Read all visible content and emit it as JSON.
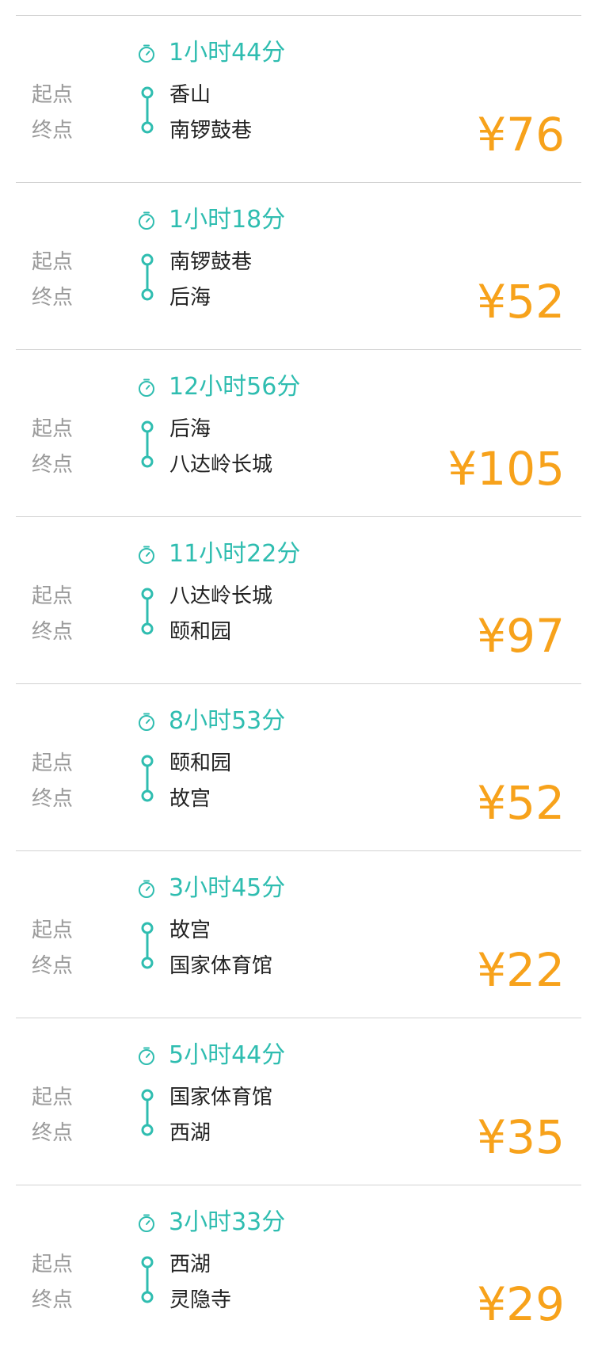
{
  "labels": {
    "start": "起点",
    "end": "终点"
  },
  "currency_symbol": "¥",
  "colors": {
    "accent_teal": "#2fbdb0",
    "price_orange": "#f7a21b",
    "label_gray": "#9a9a9a",
    "text_dark": "#222222",
    "divider": "#d2d2d2"
  },
  "icons": {
    "duration": "stopwatch-icon",
    "route": "route-line-icon"
  },
  "trips": [
    {
      "duration": "1小时44分",
      "from": "香山",
      "to": "南锣鼓巷",
      "price": "¥76"
    },
    {
      "duration": "1小时18分",
      "from": "南锣鼓巷",
      "to": "后海",
      "price": "¥52"
    },
    {
      "duration": "12小时56分",
      "from": "后海",
      "to": "八达岭长城",
      "price": "¥105"
    },
    {
      "duration": "11小时22分",
      "from": "八达岭长城",
      "to": "颐和园",
      "price": "¥97"
    },
    {
      "duration": "8小时53分",
      "from": "颐和园",
      "to": "故宫",
      "price": "¥52"
    },
    {
      "duration": "3小时45分",
      "from": "故宫",
      "to": "国家体育馆",
      "price": "¥22"
    },
    {
      "duration": "5小时44分",
      "from": "国家体育馆",
      "to": "西湖",
      "price": "¥35"
    },
    {
      "duration": "3小时33分",
      "from": "西湖",
      "to": "灵隐寺",
      "price": "¥29"
    }
  ]
}
